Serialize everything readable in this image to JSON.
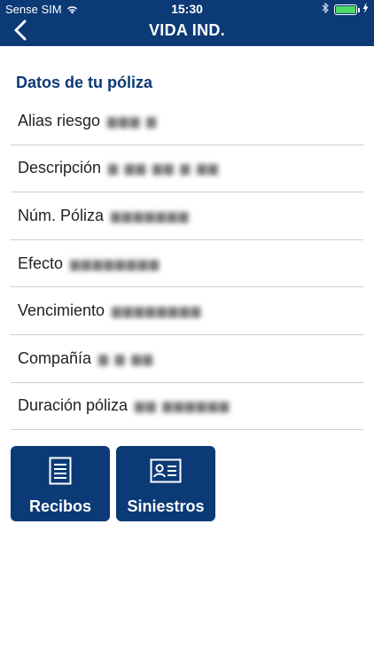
{
  "status_bar": {
    "carrier": "Sense SIM",
    "time": "15:30",
    "wifi_icon": "wifi-icon",
    "bluetooth_icon": "bluetooth-icon",
    "battery_icon": "battery-icon",
    "battery_level": 1.0,
    "charging_icon": "charging-bolt-icon"
  },
  "navbar": {
    "title": "VIDA IND.",
    "back_icon": "chevron-left-icon"
  },
  "policy": {
    "section_title": "Datos de tu póliza",
    "rows": [
      {
        "label": "Alias riesgo",
        "value": "▆▆▆ ▆"
      },
      {
        "label": "Descripción",
        "value": "▆ ▆▆ ▆▆ ▆ ▆▆"
      },
      {
        "label": "Núm. Póliza",
        "value": "▆▆▆▆▆▆▆"
      },
      {
        "label": "Efecto",
        "value": "▆▆▆▆▆▆▆▆"
      },
      {
        "label": "Vencimiento",
        "value": "▆▆▆▆▆▆▆▆"
      },
      {
        "label": "Compañía",
        "value": "▆ ▆ ▆▆"
      },
      {
        "label": "Duración póliza",
        "value": "▆▆ ▆▆▆▆▆▆"
      }
    ]
  },
  "actions": {
    "receipts": {
      "label": "Recibos",
      "icon": "document-icon"
    },
    "claims": {
      "label": "Siniestros",
      "icon": "id-card-icon"
    }
  },
  "colors": {
    "brand": "#0b3a76",
    "accent_battery": "#4cd964",
    "divider": "#cfcfcf"
  }
}
